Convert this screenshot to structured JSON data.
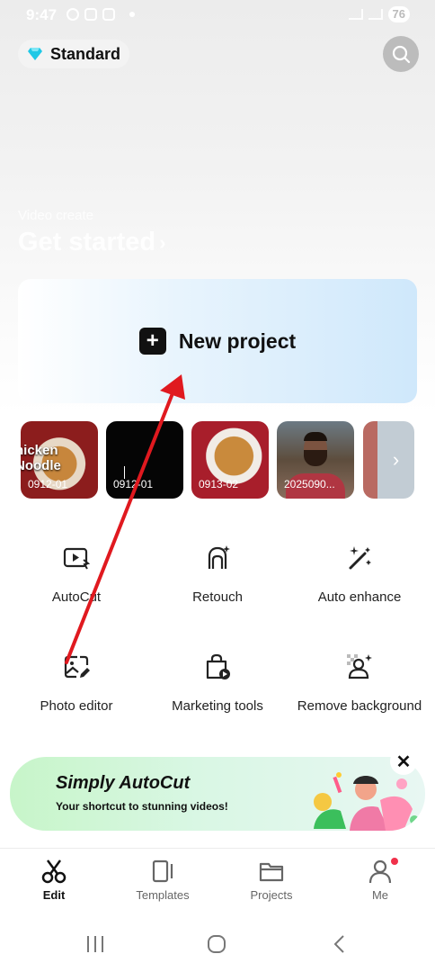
{
  "status_bar": {
    "time": "9:47",
    "battery": "76"
  },
  "header": {
    "plan_label": "Standard"
  },
  "hero": {
    "subtitle": "Video create",
    "title": "Get started"
  },
  "new_project": {
    "label": "New project"
  },
  "recent": {
    "items": [
      {
        "label": "0912-01",
        "overlay_title": "hicken Noodle"
      },
      {
        "label": "0912-01"
      },
      {
        "label": "0913-02"
      },
      {
        "label": "2025090..."
      }
    ]
  },
  "tools": [
    {
      "label": "AutoCut",
      "icon": "autocut-icon"
    },
    {
      "label": "Retouch",
      "icon": "retouch-icon"
    },
    {
      "label": "Auto enhance",
      "icon": "magic-wand-icon"
    },
    {
      "label": "Photo editor",
      "icon": "photo-edit-icon"
    },
    {
      "label": "Marketing tools",
      "icon": "shopping-bag-icon"
    },
    {
      "label": "Remove background",
      "icon": "remove-background-icon"
    }
  ],
  "promo": {
    "title": "Simply AutoCut",
    "subtitle": "Your shortcut to stunning videos!"
  },
  "bottom_nav": {
    "items": [
      {
        "label": "Edit",
        "icon": "scissors-icon",
        "active": true
      },
      {
        "label": "Templates",
        "icon": "templates-icon"
      },
      {
        "label": "Projects",
        "icon": "folder-icon"
      },
      {
        "label": "Me",
        "icon": "person-icon"
      }
    ]
  },
  "colors": {
    "accent_diamond": "#1ec8e6",
    "arrow": "#e0191f",
    "notification_dot": "#f0304a"
  }
}
